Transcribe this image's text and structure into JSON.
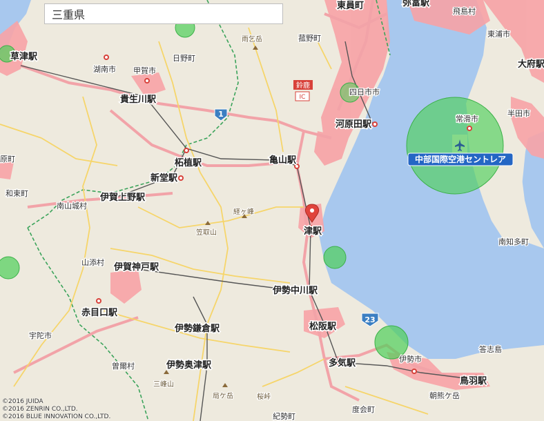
{
  "search": {
    "value": "三重県"
  },
  "stations": [
    {
      "name": "草津駅"
    },
    {
      "name": "貴生川駅"
    },
    {
      "name": "河原田駅"
    },
    {
      "name": "柘植駅"
    },
    {
      "name": "亀山駅"
    },
    {
      "name": "新堂駅"
    },
    {
      "name": "伊賀上野駅"
    },
    {
      "name": "津駅"
    },
    {
      "name": "伊賀神戸駅"
    },
    {
      "name": "伊勢中川駅"
    },
    {
      "name": "赤目口駅"
    },
    {
      "name": "松阪駅"
    },
    {
      "name": "伊勢鎌倉駅"
    },
    {
      "name": "多気駅"
    },
    {
      "name": "伊勢奥津駅"
    },
    {
      "name": "鳥羽駅"
    },
    {
      "name": "東員町"
    },
    {
      "name": "弥富駅"
    },
    {
      "name": "大府駅"
    }
  ],
  "cities": [
    {
      "name": "湖南市"
    },
    {
      "name": "甲賀市"
    },
    {
      "name": "日野町"
    },
    {
      "name": "菰野町"
    },
    {
      "name": "四日市市"
    },
    {
      "name": "常滑市"
    },
    {
      "name": "半田市"
    },
    {
      "name": "東浦市"
    },
    {
      "name": "飛島村"
    },
    {
      "name": "南知多町"
    },
    {
      "name": "原町"
    },
    {
      "name": "和束町"
    },
    {
      "name": "南山城村"
    },
    {
      "name": "山添村"
    },
    {
      "name": "宇陀市"
    },
    {
      "name": "曽爾村"
    },
    {
      "name": "伊勢市"
    },
    {
      "name": "度会町"
    },
    {
      "name": "紀勢町"
    },
    {
      "name": "答志島"
    },
    {
      "name": "朝熊ケ岳"
    },
    {
      "name": "東員町"
    }
  ],
  "mountains": [
    {
      "name": "雨乞岳"
    },
    {
      "name": "経ヶ峰"
    },
    {
      "name": "笠取山"
    },
    {
      "name": "三峰山"
    },
    {
      "name": "局ケ岳"
    },
    {
      "name": "桜峠"
    }
  ],
  "airport": {
    "name": "中部国際空港セントレア"
  },
  "interchange": {
    "name": "鈴鹿",
    "code": "IC"
  },
  "route_shields": [
    "1",
    "23"
  ],
  "copyright": [
    "©2016 JUIDA",
    "©2016 ZENRIN CO.,LTD.",
    "©2016 BLUE INNOVATION CO.,LTD."
  ],
  "colors": {
    "land": "#eeeade",
    "sea": "#a8c8ee",
    "urban": "#f7a3a6",
    "prefecture_boundary": "#3aa35a",
    "road_major": "#f2a3a8",
    "road_minor": "#f6d56a",
    "no_fly_circle": "#4fcf5a",
    "airport_label_bg": "#2466c4"
  }
}
